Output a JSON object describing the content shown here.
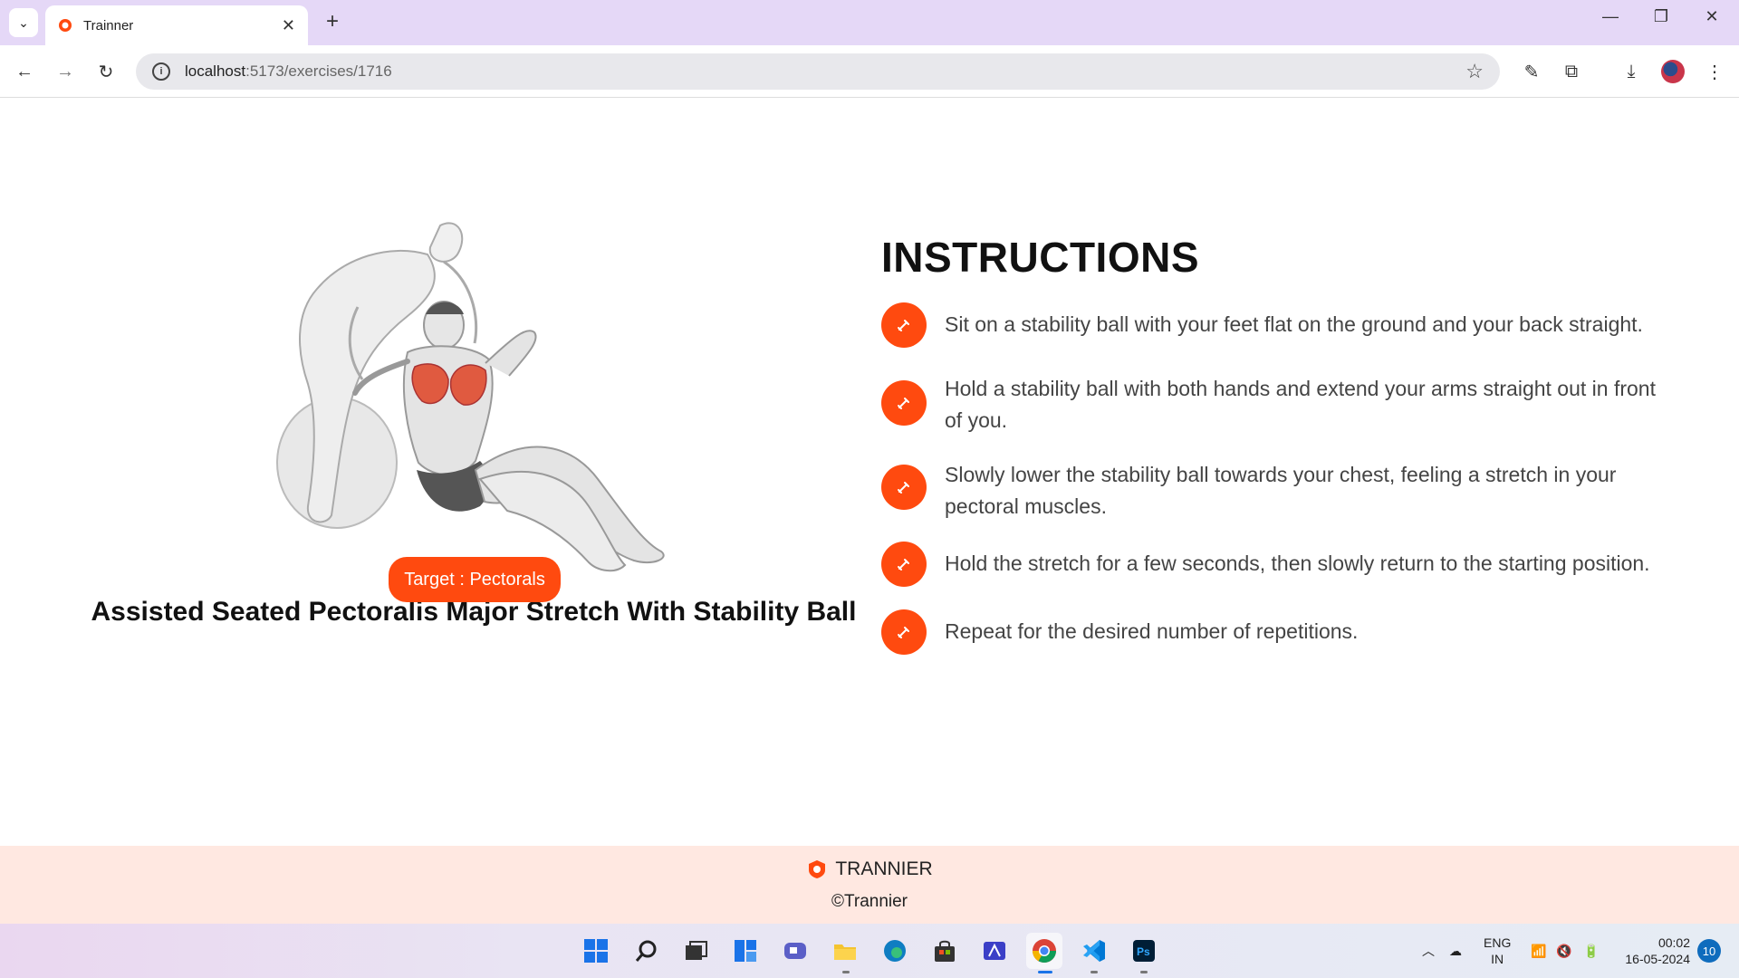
{
  "browser": {
    "tab_title": "Trainner",
    "url_host": "localhost",
    "url_path": ":5173/exercises/1716"
  },
  "exercise": {
    "name": "Assisted Seated Pectoralis Major Stretch With Stability Ball",
    "target_label": "Target : Pectorals"
  },
  "instructions": {
    "heading": "INSTRUCTIONS",
    "steps": [
      "Sit on a stability ball with your feet flat on the ground and your back straight.",
      "Hold a stability ball with both hands and extend your arms straight out in front of you.",
      "Slowly lower the stability ball towards your chest, feeling a stretch in your pectoral muscles.",
      "Hold the stretch for a few seconds, then slowly return to the starting position.",
      "Repeat for the desired number of repetitions."
    ]
  },
  "footer": {
    "brand": "TRANNIER",
    "copyright": "©Trannier"
  },
  "taskbar": {
    "lang_top": "ENG",
    "lang_bottom": "IN",
    "time": "00:02",
    "date": "16-05-2024",
    "notifications": "10"
  },
  "colors": {
    "accent": "#ff4a0f",
    "footer_bg": "#ffe8e1",
    "tabbar_bg": "#e5d8f7"
  }
}
